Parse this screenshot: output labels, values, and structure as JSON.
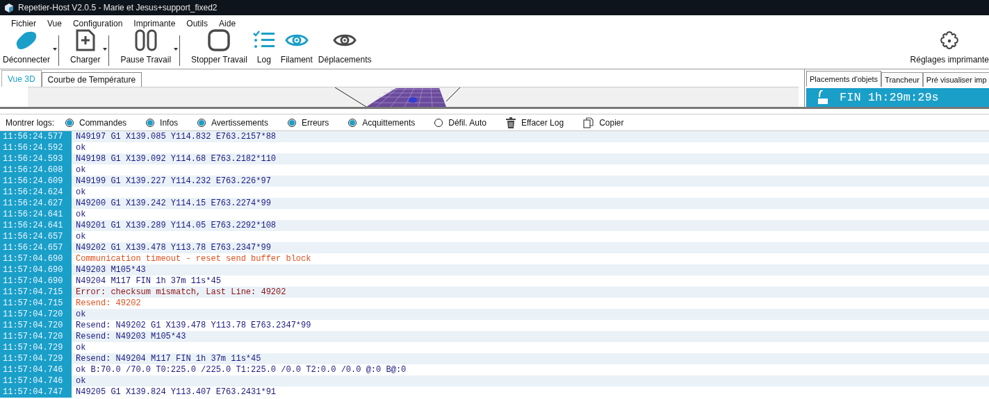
{
  "window": {
    "title": "Repetier-Host V2.0.5 - Marie et Jesus+support_fixed2"
  },
  "menu": [
    "Fichier",
    "Vue",
    "Configuration",
    "Imprimante",
    "Outils",
    "Aide"
  ],
  "toolbar": [
    {
      "label": "Déconnecter",
      "kind": "connect",
      "active": true,
      "dropdown": true
    },
    {
      "label": "Charger",
      "kind": "load",
      "active": false,
      "dropdown": true
    },
    {
      "label": "Pause Travail",
      "kind": "pause",
      "active": false,
      "dropdown": true
    },
    {
      "label": "Stopper Travail",
      "kind": "stop",
      "active": false,
      "dropdown": false
    },
    {
      "label": "Log",
      "kind": "log",
      "active": true,
      "dropdown": false
    },
    {
      "label": "Filament",
      "kind": "view",
      "active": true,
      "dropdown": false
    },
    {
      "label": "Déplacements",
      "kind": "view",
      "active": false,
      "dropdown": false
    }
  ],
  "settings_button": {
    "label": "Réglages imprimante"
  },
  "view_tabs": [
    {
      "label": "Vue 3D",
      "selected": true
    },
    {
      "label": "Courbe de Température",
      "selected": false
    }
  ],
  "right_tabs": [
    {
      "label": "Placements d'objets",
      "selected": true
    },
    {
      "label": "Trancheur",
      "selected": false
    },
    {
      "label": "Pré visualiser imp",
      "selected": false
    }
  ],
  "print_status": {
    "text": "FIN 1h:29m:29s"
  },
  "log_filters": {
    "label": "Montrer logs:",
    "options": [
      {
        "label": "Commandes",
        "checked": true
      },
      {
        "label": "Infos",
        "checked": true
      },
      {
        "label": "Avertissements",
        "checked": true
      },
      {
        "label": "Erreurs",
        "checked": true
      },
      {
        "label": "Acquittements",
        "checked": true
      },
      {
        "label": "Défil. Auto",
        "checked": false
      }
    ],
    "actions": [
      {
        "label": "Effacer Log"
      },
      {
        "label": "Copier"
      }
    ]
  },
  "log": [
    {
      "time": "11:56:24.577",
      "text": "N49197 G1 X139.085 Y114.832 E763.2157*88",
      "kind": "command"
    },
    {
      "time": "11:56:24.592",
      "text": "ok",
      "kind": "command"
    },
    {
      "time": "11:56:24.593",
      "text": "N49198 G1 X139.092 Y114.68 E763.2182*110",
      "kind": "command"
    },
    {
      "time": "11:56:24.608",
      "text": "ok",
      "kind": "command"
    },
    {
      "time": "11:56:24.609",
      "text": "N49199 G1 X139.227 Y114.232 E763.226*97",
      "kind": "command"
    },
    {
      "time": "11:56:24.624",
      "text": "ok",
      "kind": "command"
    },
    {
      "time": "11:56:24.627",
      "text": "N49200 G1 X139.242 Y114.15 E763.2274*99",
      "kind": "command"
    },
    {
      "time": "11:56:24.641",
      "text": "ok",
      "kind": "command"
    },
    {
      "time": "11:56:24.641",
      "text": "N49201 G1 X139.289 Y114.05 E763.2292*108",
      "kind": "command"
    },
    {
      "time": "11:56:24.657",
      "text": "ok",
      "kind": "command"
    },
    {
      "time": "11:56:24.657",
      "text": "N49202 G1 X139.478 Y113.78 E763.2347*99",
      "kind": "command"
    },
    {
      "time": "11:57:04.690",
      "text": "Communication timeout - reset send buffer block",
      "kind": "warning"
    },
    {
      "time": "11:57:04.690",
      "text": "N49203 M105*43",
      "kind": "command"
    },
    {
      "time": "11:57:04.690",
      "text": "N49204 M117 FIN 1h 37m 11s*45",
      "kind": "command"
    },
    {
      "time": "11:57:04.715",
      "text": "Error: checksum mismatch, Last Line: 49202",
      "kind": "error"
    },
    {
      "time": "11:57:04.715",
      "text": "Resend: 49202",
      "kind": "warning"
    },
    {
      "time": "11:57:04.720",
      "text": "ok",
      "kind": "command"
    },
    {
      "time": "11:57:04.720",
      "text": "Resend: N49202 G1 X139.478 Y113.78 E763.2347*99",
      "kind": "command"
    },
    {
      "time": "11:57:04.720",
      "text": "Resend: N49203 M105*43",
      "kind": "command"
    },
    {
      "time": "11:57:04.729",
      "text": "ok",
      "kind": "command"
    },
    {
      "time": "11:57:04.729",
      "text": "Resend: N49204 M117 FIN 1h 37m 11s*45",
      "kind": "command"
    },
    {
      "time": "11:57:04.746",
      "text": "ok B:70.0 /70.0 T0:225.0 /225.0 T1:225.0 /0.0 T2:0.0 /0.0 @:0 B@:0",
      "kind": "command"
    },
    {
      "time": "11:57:04.746",
      "text": "ok",
      "kind": "command"
    },
    {
      "time": "11:57:04.747",
      "text": "N49205 G1 X139.824 Y113.407 E763.2431*91",
      "kind": "command"
    }
  ]
}
